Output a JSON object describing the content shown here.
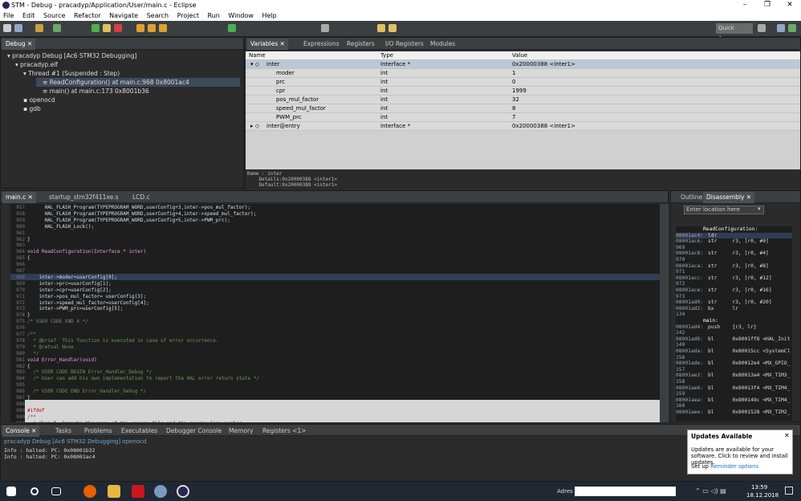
{
  "window": {
    "title": "STM - Debug - pracadyp/Application/User/main.c - Eclipse",
    "min": "–",
    "max": "❐",
    "close": "✕"
  },
  "menu": [
    "File",
    "Edit",
    "Source",
    "Refactor",
    "Navigate",
    "Search",
    "Project",
    "Run",
    "Window",
    "Help"
  ],
  "toolbar": {
    "quick_access": "Quick Access"
  },
  "debug": {
    "tab": "Debug",
    "tree": [
      "pracadyp Debug [Ac6 STM32 Debugging]",
      "pracadyp.elf",
      "Thread #1 (Suspended : Step)",
      "ReadConfiguration() at main.c:968 0x8001ac4",
      "main() at main.c:173 0x8001b36",
      "openocd",
      "gdb"
    ]
  },
  "variables": {
    "tabs": [
      "Variables",
      "Expressions",
      "Registers",
      "I/O Registers",
      "Modules"
    ],
    "headers": [
      "Name",
      "Type",
      "Value"
    ],
    "rows": [
      [
        "inter",
        "Interface *",
        "0x20000388 <inter1>"
      ],
      [
        "moder",
        "int",
        "1"
      ],
      [
        "prc",
        "int",
        "0"
      ],
      [
        "cpr",
        "int",
        "1999"
      ],
      [
        "pos_mul_factor",
        "int",
        "32"
      ],
      [
        "speed_mul_factor",
        "int",
        "8"
      ],
      [
        "PWM_prc",
        "int",
        "7"
      ],
      [
        "inter@entry",
        "Interface *",
        "0x20000388 <inter1>"
      ]
    ],
    "detail": [
      "Name : inter",
      "    Details:0x20000388 <inter1>",
      "    Default:0x20000388 <inter1>"
    ]
  },
  "editor": {
    "tabs": [
      "main.c",
      "startup_stm32f411xe.s",
      "LCD.c"
    ],
    "lines": [
      [
        "957",
        "      HAL_FLASH_Program(TYPEPROGRAM_WORD,userConfig+3,inter->pos_mul_factor);"
      ],
      [
        "958",
        "      HAL_FLASH_Program(TYPEPROGRAM_WORD,userConfig+4,inter->speed_mul_factor);"
      ],
      [
        "959",
        "      HAL_FLASH_Program(TYPEPROGRAM_WORD,userConfig+5,inter->PWM_prc);"
      ],
      [
        "960",
        "      HAL_FLASH_Lock();"
      ],
      [
        "961",
        ""
      ],
      [
        "962",
        "}"
      ],
      [
        "963",
        ""
      ],
      [
        "964",
        "void ReadConfiguration(Interface * inter)"
      ],
      [
        "965",
        "{"
      ],
      [
        "966",
        ""
      ],
      [
        "967",
        ""
      ],
      [
        "968",
        "    inter->moder=userConfig[0];"
      ],
      [
        "969",
        "    inter->prc=userConfig[1];"
      ],
      [
        "970",
        "    inter->cpr=userConfig[2];"
      ],
      [
        "971",
        "    inter->pos_mul_factor= userConfig[3];"
      ],
      [
        "972",
        "    inter->speed_mul_factor=userConfig[4];"
      ],
      [
        "973",
        "    inter->PWM_prc=userConfig[5];"
      ],
      [
        "974",
        "}"
      ],
      [
        "975",
        "/* USER CODE END 4 */"
      ],
      [
        "976",
        ""
      ],
      [
        "977",
        "/**"
      ],
      [
        "978",
        "  * @brief  This function is executed in case of error occurrence."
      ],
      [
        "979",
        "  * @retval None"
      ],
      [
        "980",
        "  */"
      ],
      [
        "981",
        "void Error_Handler(void)"
      ],
      [
        "982",
        "{"
      ],
      [
        "983",
        "  /* USER CODE BEGIN Error_Handler_Debug */"
      ],
      [
        "984",
        "  /* User can add his own implementation to report the HAL error return state */"
      ],
      [
        "985",
        ""
      ],
      [
        "986",
        "  /* USER CODE END Error_Handler_Debug */"
      ],
      [
        "987",
        "}"
      ],
      [
        "988",
        ""
      ],
      [
        "989",
        "#ifdef"
      ],
      [
        "990",
        "/**"
      ],
      [
        "991",
        "  * @brief  Reports the name of the source file and the source line number"
      ]
    ]
  },
  "disasm": {
    "tabs": [
      "Outline",
      "Disassembly"
    ],
    "location": "Enter location here",
    "lines": [
      [
        "",
        "ReadConfiguration:"
      ],
      [
        "08001ac4:",
        "ldr"
      ],
      [
        "08001ac6:",
        "str     r3, [r0, #0]"
      ],
      [
        "969",
        ""
      ],
      [
        "08001ac8:",
        "str     r3, [r0, #4]"
      ],
      [
        "970",
        ""
      ],
      [
        "08001aca:",
        "str     r3, [r0, #8]"
      ],
      [
        "971",
        ""
      ],
      [
        "08001acc:",
        "str     r3, [r0, #12]"
      ],
      [
        "972",
        ""
      ],
      [
        "08001ace:",
        "str     r3, [r0, #16]"
      ],
      [
        "973",
        ""
      ],
      [
        "08001ad0:",
        "str     r3, [r0, #20]"
      ],
      [
        "08001ad2:",
        "bx      lr"
      ],
      [
        "134",
        ""
      ],
      [
        "",
        "main:"
      ],
      [
        "08001ad4:",
        "push    {r3, lr}"
      ],
      [
        "142",
        ""
      ],
      [
        "08001ad6:",
        "bl      0x8001ff8 <HAL_Init"
      ],
      [
        "149",
        ""
      ],
      [
        "08001ada:",
        "bl      0x80015cc <SystemCl"
      ],
      [
        "156",
        ""
      ],
      [
        "08001ade:",
        "bl      0x80012e4 <MX_GPIO_"
      ],
      [
        "157",
        ""
      ],
      [
        "08001ae2:",
        "bl      0x80013a4 <MX_TIM3_"
      ],
      [
        "158",
        ""
      ],
      [
        "08001ae6:",
        "bl      0x80013f4 <MX_TIM4_"
      ],
      [
        "159",
        ""
      ],
      [
        "08001aea:",
        "bl      0x800149c <MX_TIM4_"
      ],
      [
        "160",
        ""
      ],
      [
        "08001aee:",
        "bl      0x8001528 <MX_TIM2_"
      ]
    ]
  },
  "console": {
    "tabs": [
      "Console",
      "Tasks",
      "Problems",
      "Executables",
      "Debugger Console",
      "Memory",
      "Registers <1>"
    ],
    "title": "pracadyp Debug [Ac6 STM32 Debugging] openocd",
    "lines": [
      "Info : halted: PC: 0x08001b32",
      "Info : halted: PC: 0x08001ac4"
    ]
  },
  "notification": {
    "title": "Updates Available",
    "body": "Updates are available for your software. Click to review and install updates.",
    "setup": "Set up",
    "reminder": "Reminder options"
  },
  "taskbar": {
    "address_label": "Adres",
    "time": "13:59",
    "date": "18.12.2018"
  }
}
